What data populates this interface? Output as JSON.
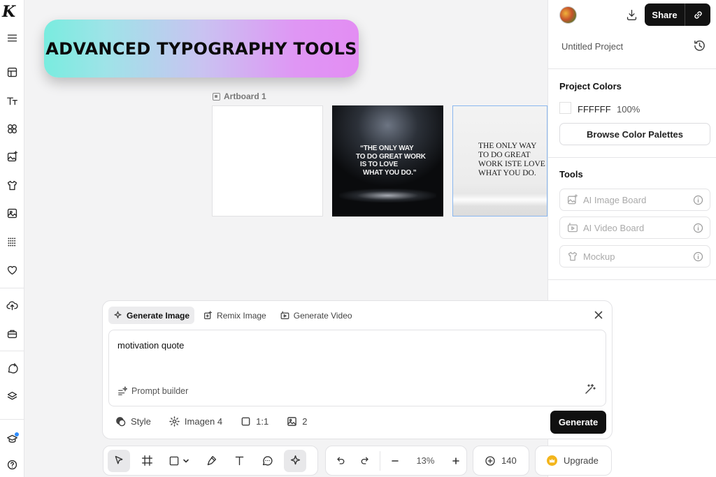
{
  "app": {
    "logo_letter": "K"
  },
  "banner": {
    "text": "ADVANCED TYPOGRAPHY TOOLS"
  },
  "artboard": {
    "label": "Artboard 1",
    "dark_quote_lines": [
      "“THE ONLY WAY",
      "TO DO GREAT WORK",
      "IS TO LOVE",
      "WHAT YOU DO.”"
    ],
    "light_quote_lines": [
      "THE ONLY WAY",
      "TO DO GREAT",
      "WORK ISTE LOVE",
      "WHAT YOU DO."
    ]
  },
  "header": {
    "share_label": "Share",
    "project_name": "Untitled Project"
  },
  "project_colors": {
    "title": "Project Colors",
    "color_hex": "FFFFFF",
    "opacity": "100%",
    "browse_label": "Browse Color Palettes"
  },
  "tools": {
    "title": "Tools",
    "items": [
      {
        "label": "AI Image Board",
        "icon": "image-sparkle-icon"
      },
      {
        "label": "AI Video Board",
        "icon": "video-icon"
      },
      {
        "label": "Mockup",
        "icon": "tshirt-icon"
      }
    ]
  },
  "generator": {
    "tabs": [
      {
        "label": "Generate Image",
        "active": true
      },
      {
        "label": "Remix Image",
        "active": false
      },
      {
        "label": "Generate Video",
        "active": false
      }
    ],
    "prompt": "motivation quote",
    "prompt_builder_label": "Prompt builder",
    "options": {
      "style_label": "Style",
      "model_label": "Imagen 4",
      "ratio_label": "1:1",
      "count_label": "2"
    },
    "generate_label": "Generate"
  },
  "toolbar": {
    "zoom": "13%",
    "credits": "140",
    "upgrade_label": "Upgrade"
  }
}
